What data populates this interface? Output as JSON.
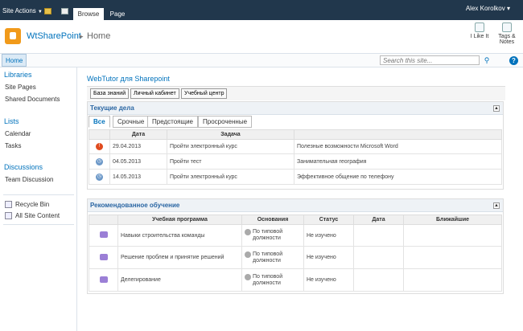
{
  "topbar": {
    "site_actions": "Site Actions",
    "tabs": [
      "Browse",
      "Page"
    ],
    "user": "Alex Korolkov"
  },
  "header": {
    "site_title": "WtSharePoint",
    "breadcrumb_sep": "▸",
    "breadcrumb_current": "Home",
    "like_it": "I Like It",
    "tags_notes_line1": "Tags &",
    "tags_notes_line2": "Notes"
  },
  "nav": {
    "home": "Home",
    "search_placeholder": "Search this site...",
    "search_icon": "search-icon",
    "help_icon": "help-icon"
  },
  "sidebar": {
    "libraries_heading": "Libraries",
    "libraries": [
      "Site Pages",
      "Shared Documents"
    ],
    "lists_heading": "Lists",
    "lists": [
      "Calendar",
      "Tasks"
    ],
    "discussions_heading": "Discussions",
    "discussions": [
      "Team Discussion"
    ],
    "recycle_bin": "Recycle Bin",
    "all_site_content": "All Site Content"
  },
  "main": {
    "title": "WebTutor для Sharepoint",
    "buttons": [
      "База знаний",
      "Личный кабинет",
      "Учебный центр"
    ],
    "current": {
      "title": "Текущие дела",
      "tabs": [
        "Все",
        "Срочные",
        "Предстоящие",
        "Просроченные"
      ],
      "columns": [
        "Дата",
        "Задача",
        ""
      ],
      "rows": [
        {
          "icon": "alert",
          "date": "29.04.2013",
          "task": "Пройти электронный курс",
          "item": "Полезные возможности Microsoft Word"
        },
        {
          "icon": "clock",
          "date": "04.05.2013",
          "task": "Пройти тест",
          "item": "Занимательная география"
        },
        {
          "icon": "clock",
          "date": "14.05.2013",
          "task": "Пройти электронный курс",
          "item": "Эффективное общение по телефону"
        }
      ]
    },
    "recommended": {
      "title": "Рекомендованное обучение",
      "columns": [
        "Учебная программа",
        "Основания",
        "Статус",
        "Дата",
        "Ближайшие"
      ],
      "rows": [
        {
          "program": "Навыки строительства команды",
          "basis1": "По типовой",
          "basis2": "должности",
          "status": "Не изучено"
        },
        {
          "program": "Решение проблем и принятие решений",
          "basis1": "По типовой",
          "basis2": "должности",
          "status": "Не изучено"
        },
        {
          "program": "Делегирование",
          "basis1": "По типовой",
          "basis2": "должности",
          "status": "Не изучено"
        }
      ]
    }
  },
  "colors": {
    "topbar": "#21374c",
    "link": "#0072bc",
    "logo": "#f19a1a"
  }
}
